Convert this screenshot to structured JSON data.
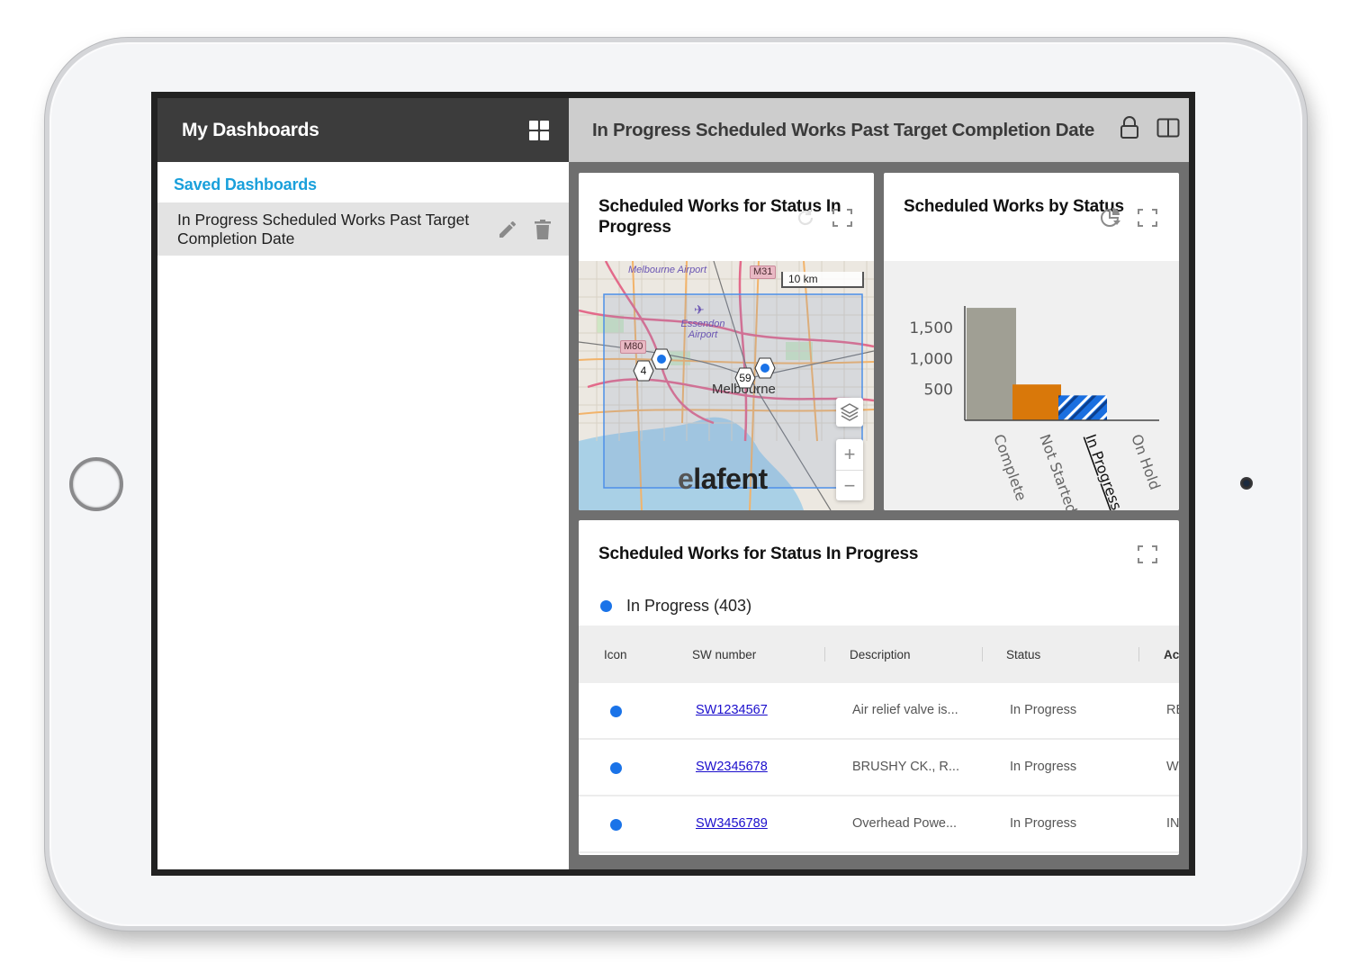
{
  "sidebar": {
    "title": "My Dashboards",
    "section_label": "Saved Dashboards",
    "items": [
      {
        "label": "In Progress Scheduled Works Past Target Completion Date"
      }
    ]
  },
  "main": {
    "title": "In Progress Scheduled Works Past Target Completion Date"
  },
  "map_card": {
    "title": "Scheduled Works for Status In Progress",
    "scale_label": "10 km",
    "labels": {
      "airport1": "Melbourne Airport",
      "airport2": "Essendon Airport",
      "city": "Melbourne",
      "shield_m31": "M31",
      "shield_m80": "M80"
    },
    "clusters": [
      {
        "count": "4"
      },
      {
        "count": "59"
      }
    ],
    "zoom_in": "+",
    "zoom_out": "−",
    "watermark_e": "e",
    "watermark_rest": "lafent"
  },
  "chart_card": {
    "title": "Scheduled Works by Status"
  },
  "chart_data": {
    "type": "bar",
    "title": "Scheduled Works by Status",
    "xlabel": "",
    "ylabel": "",
    "categories": [
      "Complete",
      "Not Started",
      "In Progress",
      "On Hold"
    ],
    "values": [
      1820,
      580,
      403,
      0
    ],
    "colors": [
      "#a09f94",
      "#d9780a",
      "#1a6fe0",
      "#888888"
    ],
    "highlighted_category": "In Progress",
    "yticks": [
      500,
      1000,
      1500
    ],
    "ytick_labels": [
      "500",
      "1,000",
      "1,500"
    ],
    "ylim": [
      0,
      1850
    ],
    "grid": false,
    "legend": "none"
  },
  "table_card": {
    "title": "Scheduled Works for Status In Progress",
    "legend": {
      "label": "In Progress (403)",
      "color": "#1a73e8"
    },
    "columns": [
      "Icon",
      "SW number",
      "Description",
      "Status",
      "Ac"
    ],
    "rows": [
      {
        "sw": "SW1234567",
        "description": "Air relief valve is...",
        "status": "In Progress",
        "action": "RE"
      },
      {
        "sw": "SW2345678",
        "description": "BRUSHY CK., R...",
        "status": "In Progress",
        "action": "W"
      },
      {
        "sw": "SW3456789",
        "description": "Overhead Powe...",
        "status": "In Progress",
        "action": "IN"
      }
    ]
  },
  "colors": {
    "accent": "#1aa0db",
    "header_dark": "#3c3c3c",
    "in_progress": "#1a73e8",
    "not_started": "#d9780a",
    "complete": "#a09f94"
  }
}
